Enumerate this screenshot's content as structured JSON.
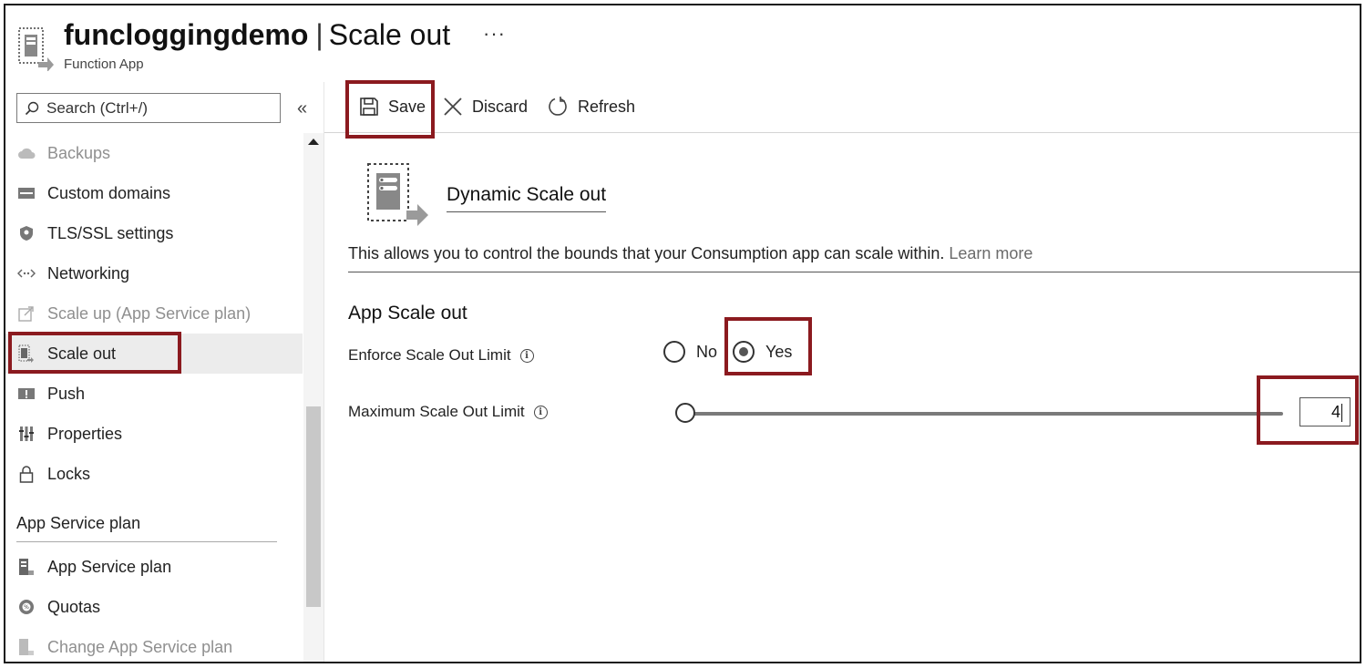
{
  "header": {
    "app_name": "funcloggingdemo",
    "separator": "|",
    "page_name": "Scale out",
    "more": "···",
    "subtitle": "Function App"
  },
  "search": {
    "placeholder": "Search (Ctrl+/)"
  },
  "collapse": "«",
  "sidebar": {
    "items": [
      {
        "label": "Backups",
        "icon": "cloud-icon",
        "disabled": true
      },
      {
        "label": "Custom domains",
        "icon": "domain-icon"
      },
      {
        "label": "TLS/SSL settings",
        "icon": "shield-icon"
      },
      {
        "label": "Networking",
        "icon": "network-icon"
      },
      {
        "label": "Scale up (App Service plan)",
        "icon": "scale-up-icon",
        "disabled": true
      },
      {
        "label": "Scale out",
        "icon": "scale-out-icon",
        "selected": true
      },
      {
        "label": "Push",
        "icon": "push-icon"
      },
      {
        "label": "Properties",
        "icon": "properties-icon"
      },
      {
        "label": "Locks",
        "icon": "lock-icon"
      }
    ],
    "section_header": "App Service plan",
    "section_items": [
      {
        "label": "App Service plan",
        "icon": "app-service-plan-icon"
      },
      {
        "label": "Quotas",
        "icon": "quotas-icon"
      },
      {
        "label": "Change App Service plan",
        "icon": "change-plan-icon",
        "disabled": true
      }
    ]
  },
  "toolbar": {
    "save_label": "Save",
    "discard_label": "Discard",
    "refresh_label": "Refresh"
  },
  "feature": {
    "title": "Dynamic Scale out",
    "description": "This allows you to control the bounds that your Consumption app can scale within.",
    "learn_more": "Learn more"
  },
  "app_scale": {
    "section_title": "App Scale out",
    "enforce_label": "Enforce Scale Out Limit",
    "enforce_options": [
      "No",
      "Yes"
    ],
    "enforce_selected": "Yes",
    "max_label": "Maximum Scale Out Limit",
    "max_value": "4",
    "slider_fraction": 0.0
  },
  "colors": {
    "highlight": "#8b1a1f",
    "selected_bg": "#ececec"
  }
}
